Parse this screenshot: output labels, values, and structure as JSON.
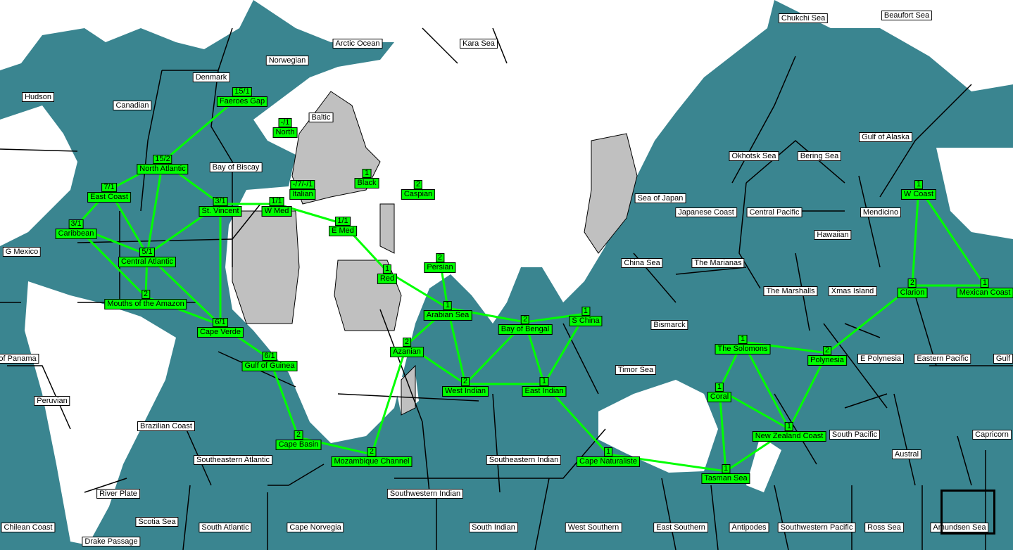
{
  "colors": {
    "ocean": "#3a8590",
    "land": "#ffffff",
    "owned_land": "#c0c0c0",
    "fleet": "#00ff00",
    "route": "#00ff00"
  },
  "sea_labels": [
    "Chukchi Sea",
    "Beaufort Sea",
    "Arctic Ocean",
    "Kara Sea",
    "Norwegian",
    "Denmark",
    "Hudson",
    "Canadian",
    "Baltic",
    "Gulf of Alaska",
    "Okhotsk Sea",
    "Bering Sea",
    "Bay of Biscay",
    "Sea of Japan",
    "Japanese Coast",
    "Central Pacific",
    "Mendicino",
    "Hawaiian",
    "G Mexico",
    "China Sea",
    "The Marianas",
    "The Marshalls",
    "Xmas Island",
    "Bismarck",
    "E Polynesia",
    "Eastern Pacific",
    "Gulf",
    "of Panama",
    "Timor Sea",
    "Peruvian",
    "Brazilian Coast",
    "South Pacific",
    "Capricorn",
    "Austral",
    "Southeastern Atlantic",
    "Southeastern Indian",
    "River Plate",
    "Southwestern Indian",
    "Scotia Sea",
    "Chilean Coast",
    "South Atlantic",
    "Cape Norvegia",
    "South Indian",
    "West Southern",
    "East Southern",
    "Antipodes",
    "Southwestern Pacific",
    "Ross Sea",
    "Amundsen Sea",
    "Drake Passage"
  ],
  "fleet_zones": [
    {
      "name": "Faeroes Gap",
      "count": "15/1"
    },
    {
      "name": "North",
      "count": "-/1"
    },
    {
      "name": "North Atlantic",
      "count": "15/2"
    },
    {
      "name": "Italian",
      "count": "-/7/-/1"
    },
    {
      "name": "Black",
      "count": "1"
    },
    {
      "name": "Caspian",
      "count": "2"
    },
    {
      "name": "East Coast",
      "count": "7/1"
    },
    {
      "name": "St. Vincent",
      "count": "3/1"
    },
    {
      "name": "W Med",
      "count": "1/1"
    },
    {
      "name": "E Med",
      "count": "1/1"
    },
    {
      "name": "Caribbean",
      "count": "3/1"
    },
    {
      "name": "Central Atlantic",
      "count": "5/1"
    },
    {
      "name": "Persian",
      "count": "2"
    },
    {
      "name": "Red",
      "count": "1"
    },
    {
      "name": "Mouths of the Amazon",
      "count": "2"
    },
    {
      "name": "Arabian Sea",
      "count": "1"
    },
    {
      "name": "Bay of Bengal",
      "count": "2"
    },
    {
      "name": "S China",
      "count": "1"
    },
    {
      "name": "Cape Verde",
      "count": "6/1"
    },
    {
      "name": "W Coast",
      "count": "1"
    },
    {
      "name": "Clarion",
      "count": "2"
    },
    {
      "name": "Mexican Coast",
      "count": "1"
    },
    {
      "name": "The Solomons",
      "count": "1"
    },
    {
      "name": "Polynesia",
      "count": "2"
    },
    {
      "name": "Azanian",
      "count": "2"
    },
    {
      "name": "Gulf of Guinea",
      "count": "6/1"
    },
    {
      "name": "West Indian",
      "count": "2"
    },
    {
      "name": "East Indian",
      "count": "1"
    },
    {
      "name": "Coral",
      "count": "1"
    },
    {
      "name": "New Zealand Coast",
      "count": "1"
    },
    {
      "name": "Cape Basin",
      "count": "2"
    },
    {
      "name": "Mozambique Channel",
      "count": "2"
    },
    {
      "name": "Cape Naturaliste",
      "count": "1"
    },
    {
      "name": "Tasman Sea",
      "count": "1"
    }
  ],
  "routes": [
    [
      "Faeroes Gap",
      "North Atlantic"
    ],
    [
      "North Atlantic",
      "East Coast"
    ],
    [
      "North Atlantic",
      "St. Vincent"
    ],
    [
      "North Atlantic",
      "Central Atlantic"
    ],
    [
      "East Coast",
      "Caribbean"
    ],
    [
      "East Coast",
      "Central Atlantic"
    ],
    [
      "Caribbean",
      "Central Atlantic"
    ],
    [
      "Caribbean",
      "Mouths of the Amazon"
    ],
    [
      "Central Atlantic",
      "Mouths of the Amazon"
    ],
    [
      "Central Atlantic",
      "St. Vincent"
    ],
    [
      "Central Atlantic",
      "Cape Verde"
    ],
    [
      "Mouths of the Amazon",
      "Cape Verde"
    ],
    [
      "St. Vincent",
      "Cape Verde"
    ],
    [
      "St. Vincent",
      "W Med"
    ],
    [
      "W Med",
      "E Med"
    ],
    [
      "E Med",
      "Red"
    ],
    [
      "Red",
      "Arabian Sea"
    ],
    [
      "Persian",
      "Arabian Sea"
    ],
    [
      "Arabian Sea",
      "Azanian"
    ],
    [
      "Arabian Sea",
      "Bay of Bengal"
    ],
    [
      "Arabian Sea",
      "West Indian"
    ],
    [
      "Azanian",
      "West Indian"
    ],
    [
      "Bay of Bengal",
      "S China"
    ],
    [
      "Bay of Bengal",
      "West Indian"
    ],
    [
      "Bay of Bengal",
      "East Indian"
    ],
    [
      "S China",
      "East Indian"
    ],
    [
      "West Indian",
      "East Indian"
    ],
    [
      "East Indian",
      "Cape Naturaliste"
    ],
    [
      "Cape Naturaliste",
      "Tasman Sea"
    ],
    [
      "Tasman Sea",
      "Coral"
    ],
    [
      "Tasman Sea",
      "New Zealand Coast"
    ],
    [
      "Coral",
      "The Solomons"
    ],
    [
      "Coral",
      "New Zealand Coast"
    ],
    [
      "The Solomons",
      "New Zealand Coast"
    ],
    [
      "The Solomons",
      "Polynesia"
    ],
    [
      "Polynesia",
      "New Zealand Coast"
    ],
    [
      "Polynesia",
      "Clarion"
    ],
    [
      "Clarion",
      "W Coast"
    ],
    [
      "Clarion",
      "Mexican Coast"
    ],
    [
      "W Coast",
      "Mexican Coast"
    ],
    [
      "Cape Verde",
      "Gulf of Guinea"
    ],
    [
      "Gulf of Guinea",
      "Cape Basin"
    ],
    [
      "Cape Basin",
      "Mozambique Channel"
    ],
    [
      "Mozambique Channel",
      "Azanian"
    ]
  ]
}
